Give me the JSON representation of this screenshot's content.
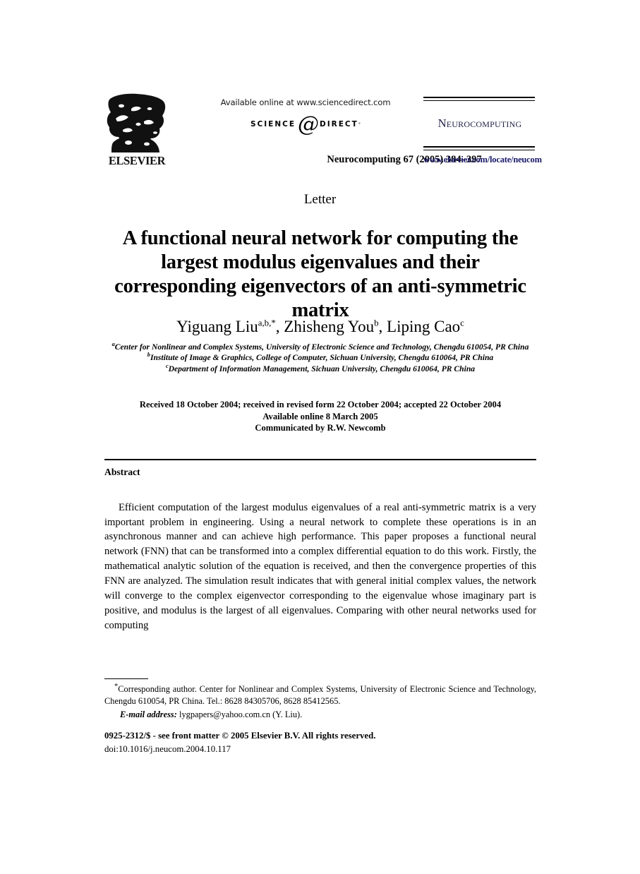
{
  "masthead": {
    "available_online": "Available online at www.sciencedirect.com",
    "sciencedirect": {
      "science": "SCIENCE",
      "at": "@",
      "direct": "DIRECT",
      "registered_mark": "°"
    },
    "publisher": "ELSEVIER",
    "citation": "Neurocomputing 67 (2005) 384–397",
    "journal_name": "Neurocomputing",
    "journal_url": "www.elsevier.com/locate/neucom",
    "link_color": "#1b1b6b"
  },
  "article": {
    "kind": "Letter",
    "title": "A functional neural network for computing the largest modulus eigenvalues and their corresponding eigenvectors of an anti-symmetric matrix",
    "authors_plain": "Yiguang Liua,b,*, Zhisheng Youb, Liping Caoc",
    "authors": [
      {
        "name": "Yiguang Liu",
        "marks": "a,b,*"
      },
      {
        "name": "Zhisheng You",
        "marks": "b"
      },
      {
        "name": "Liping Cao",
        "marks": "c"
      }
    ],
    "affiliations": [
      {
        "mark": "a",
        "text": "Center for Nonlinear and Complex Systems, University of Electronic Science and Technology, Chengdu 610054, PR China"
      },
      {
        "mark": "b",
        "text": "Institute of Image & Graphics, College of Computer, Sichuan University, Chengdu 610064, PR China"
      },
      {
        "mark": "c",
        "text": "Department of Information Management, Sichuan University, Chengdu 610064, PR China"
      }
    ],
    "history": [
      "Received 18 October 2004; received in revised form 22 October 2004; accepted 22 October 2004",
      "Available online 8 March 2005",
      "Communicated by R.W. Newcomb"
    ]
  },
  "abstract": {
    "label": "Abstract",
    "text": "Efficient computation of the largest modulus eigenvalues of a real anti-symmetric matrix is a very important problem in engineering. Using a neural network to complete these operations is in an asynchronous manner and can achieve high performance. This paper proposes a functional neural network (FNN) that can be transformed into a complex differential equation to do this work. Firstly, the mathematical analytic solution of the equation is received, and then the convergence properties of this FNN are analyzed. The simulation result indicates that with general initial complex values, the network will converge to the complex eigenvector corresponding to the eigenvalue whose imaginary part is positive, and modulus is the largest of all eigenvalues. Comparing with other neural networks used for computing"
  },
  "footnote": {
    "corresponding_mark": "*",
    "corresponding_text": "Corresponding author. Center for Nonlinear and Complex Systems, University of Electronic Science and Technology, Chengdu 610054, PR China. Tel.: 8628 84305706, 8628 85412565.",
    "email_label": "E-mail address:",
    "email_value": "lygpapers@yahoo.com.cn (Y. Liu)."
  },
  "imprint": {
    "line1": "0925-2312/$ - see front matter © 2005 Elsevier B.V. All rights reserved.",
    "line2": "doi:10.1016/j.neucom.2004.10.117"
  }
}
